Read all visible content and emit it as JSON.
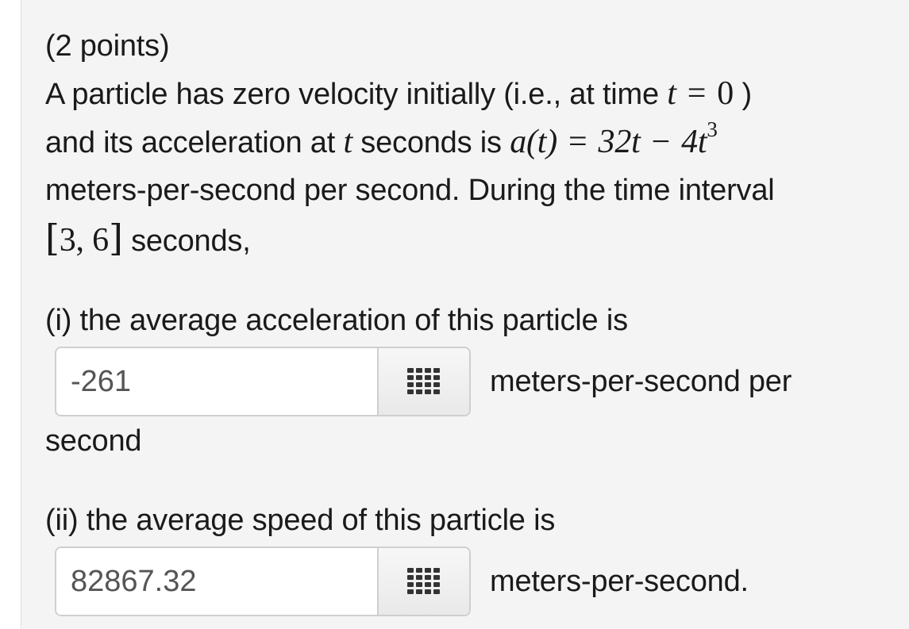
{
  "problem": {
    "points": "(2 points)",
    "stmt1_text": "A particle has zero velocity initially (i.e., at time",
    "stmt1_var": "t",
    "stmt1_eq": "=",
    "stmt1_val": "0",
    "stmt1_close": ")",
    "stmt2_a": "and its acceleration at",
    "stmt2_var": "t",
    "stmt2_b": "seconds is",
    "stmt2_func": "a(t)",
    "stmt2_eq": "=",
    "stmt2_term1": "32t",
    "stmt2_minus": "−",
    "stmt2_term2": "4t",
    "stmt2_exp": "3",
    "stmt3": "meters-per-second per second. During the time interval",
    "interval_open": "[",
    "interval_vals": "3, 6",
    "interval_close": "]",
    "stmt4": "seconds,"
  },
  "part1": {
    "prompt": "(i) the average acceleration of this particle is",
    "answer_value": "-261",
    "unit_inline": "meters-per-second per",
    "unit_wrap": "second"
  },
  "part2": {
    "prompt": "(ii) the average speed of this particle is",
    "answer_value": "82867.32",
    "unit_inline": "meters-per-second."
  },
  "icons": {
    "keypad": "keypad-grid-icon"
  }
}
